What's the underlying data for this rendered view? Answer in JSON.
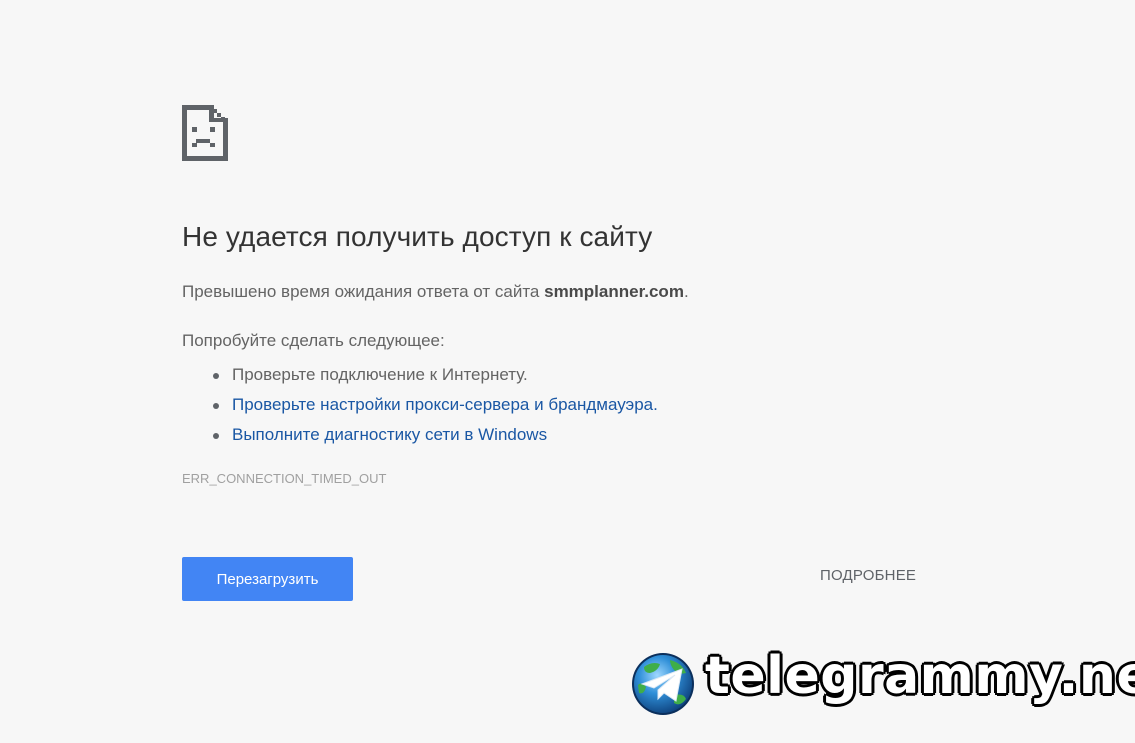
{
  "error_page": {
    "icon": "sad-page-icon",
    "title": "Не удается получить доступ к сайту",
    "message_prefix": "Превышено время ожидания ответа от сайта ",
    "message_host": "smmplanner.com",
    "message_suffix": ".",
    "suggestions_heading": "Попробуйте сделать следующее:",
    "suggestions": [
      {
        "text": "Проверьте подключение к Интернету.",
        "is_link": false
      },
      {
        "text": "Проверьте настройки прокси-сервера и брандмауэра.",
        "is_link": true
      },
      {
        "text": "Выполните диагностику сети в Windows",
        "is_link": true
      }
    ],
    "error_code": "ERR_CONNECTION_TIMED_OUT",
    "reload_label": "Перезагрузить",
    "details_label": "ПОДРОБНЕЕ"
  },
  "watermark": {
    "icon": "telegram-globe-icon",
    "text": "telegrammy.net"
  },
  "colors": {
    "background": "#f7f7f7",
    "title": "#333333",
    "body_text": "#646464",
    "link": "#1a57a4",
    "button": "#4285f4",
    "error_code": "#a0a0a0"
  }
}
